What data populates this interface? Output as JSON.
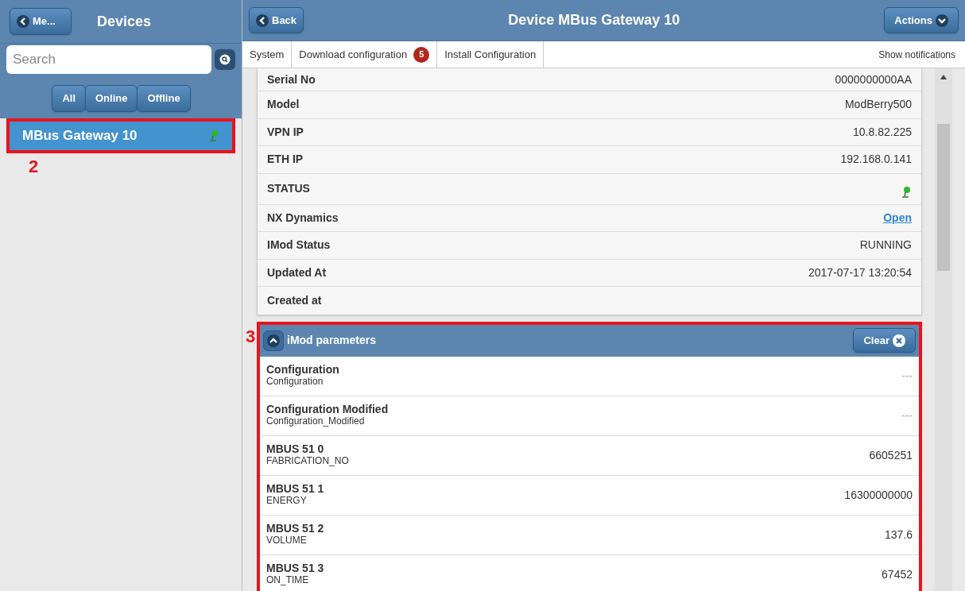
{
  "sidebar": {
    "back_button": "Me...",
    "title": "Devices",
    "search": {
      "placeholder": "Search"
    },
    "filters": [
      {
        "label": "All"
      },
      {
        "label": "Online"
      },
      {
        "label": "Offline"
      }
    ],
    "devices": [
      {
        "name": "MBus Gateway 10",
        "selected": true,
        "online": true
      }
    ],
    "annotation": "2"
  },
  "header": {
    "back_button": "Back",
    "title": "Device MBus Gateway 10",
    "actions_button": "Actions"
  },
  "tabs": [
    {
      "label": "System"
    },
    {
      "label": "Download configuration",
      "badge": "5"
    },
    {
      "label": "Install Configuration"
    }
  ],
  "notifications_link": "Show notifications",
  "info_rows": [
    {
      "kind": "text",
      "label": "Serial No",
      "value": "0000000000AA"
    },
    {
      "kind": "text",
      "label": "Model",
      "value": "ModBerry500"
    },
    {
      "kind": "text",
      "label": "VPN IP",
      "value": "10.8.82.225"
    },
    {
      "kind": "text",
      "label": "ETH IP",
      "value": "192.168.0.141"
    },
    {
      "kind": "status",
      "label": "STATUS",
      "online": true
    },
    {
      "kind": "link",
      "label": "NX Dynamics",
      "value": "Open"
    },
    {
      "kind": "text",
      "label": "IMod Status",
      "value": "RUNNING"
    },
    {
      "kind": "text",
      "label": "Updated At",
      "value": "2017-07-17 13:20:54"
    },
    {
      "kind": "text",
      "label": "Created at"
    }
  ],
  "parameters": {
    "annotation": "3",
    "title": "iMod parameters",
    "expanded": true,
    "clear_button": "Clear",
    "rows": [
      {
        "name": "Configuration",
        "key": "Configuration",
        "value": "---"
      },
      {
        "name": "Configuration Modified",
        "key": "Configuration_Modified",
        "value": "---"
      },
      {
        "name": "MBUS 51 0",
        "key": "FABRICATION_NO",
        "value": "6605251"
      },
      {
        "name": "MBUS 51 1",
        "key": "ENERGY",
        "value": "16300000000"
      },
      {
        "name": "MBUS 51 2",
        "key": "VOLUME",
        "value": "137.6"
      },
      {
        "name": "MBUS 51 3",
        "key": "ON_TIME",
        "value": "67452"
      }
    ]
  }
}
